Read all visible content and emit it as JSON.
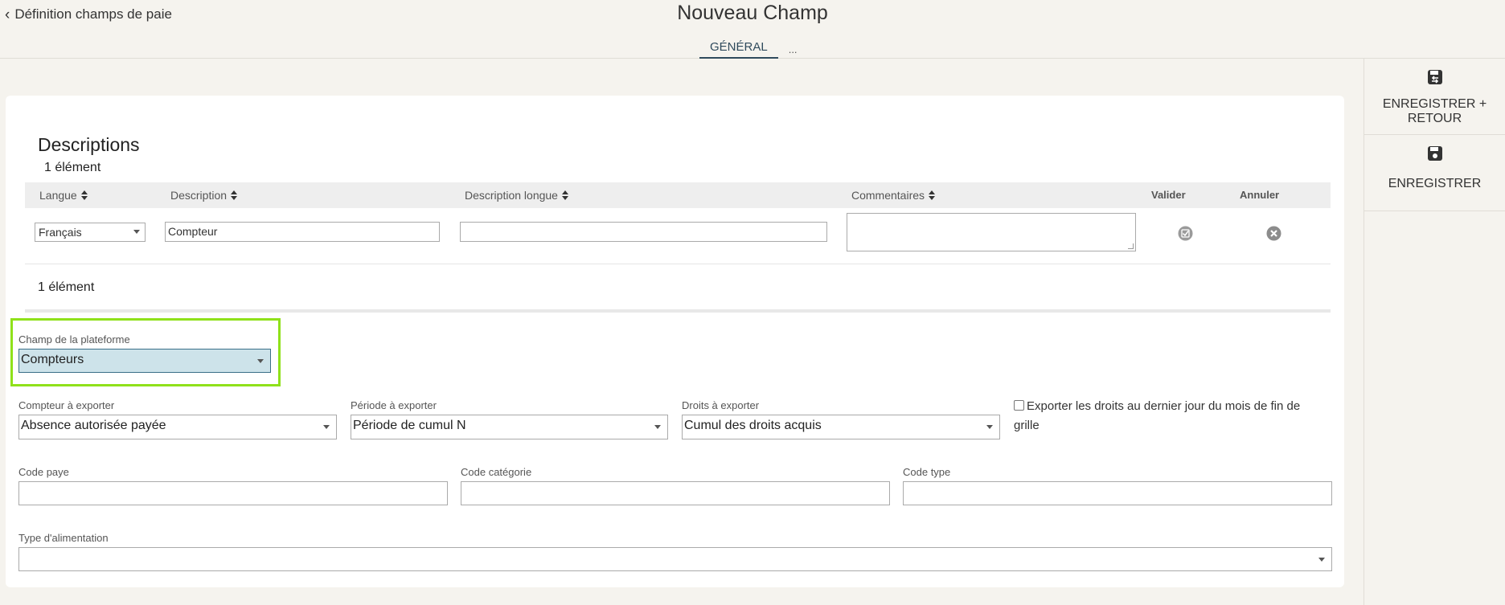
{
  "header": {
    "back_label": "Définition champs de paie",
    "title": "Nouveau Champ",
    "tabs": [
      {
        "label": "GÉNÉRAL",
        "active": true
      },
      {
        "label": "..."
      }
    ]
  },
  "actions": {
    "save_return_line1": "ENREGISTRER +",
    "save_return_line2": "RETOUR",
    "save": "ENREGISTRER"
  },
  "descriptions": {
    "title": "Descriptions",
    "count_top": "1 élément",
    "count_bottom": "1 élément",
    "columns": {
      "langue": "Langue",
      "description": "Description",
      "description_longue": "Description longue",
      "commentaires": "Commentaires",
      "valider": "Valider",
      "annuler": "Annuler"
    },
    "row": {
      "langue": "Français",
      "description": "Compteur",
      "description_longue": "",
      "commentaires": ""
    }
  },
  "form": {
    "champ_plateforme": {
      "label": "Champ de la plateforme",
      "value": "Compteurs"
    },
    "compteur": {
      "label": "Compteur à exporter",
      "value": "Absence autorisée payée"
    },
    "periode": {
      "label": "Période à exporter",
      "value": "Période de cumul N"
    },
    "droits": {
      "label": "Droits à exporter",
      "value": "Cumul des droits acquis"
    },
    "exporter_checkbox": {
      "label": "Exporter les droits au dernier jour du mois de fin de grille",
      "checked": false
    },
    "code_paye": {
      "label": "Code paye",
      "value": ""
    },
    "code_categorie": {
      "label": "Code catégorie",
      "value": ""
    },
    "code_type": {
      "label": "Code type",
      "value": ""
    },
    "type_alimentation": {
      "label": "Type d'alimentation",
      "value": ""
    }
  },
  "colors": {
    "highlight_border": "#8fe11a",
    "selected_bg": "#cde3ea",
    "tab_accent": "#2f4a5c"
  }
}
